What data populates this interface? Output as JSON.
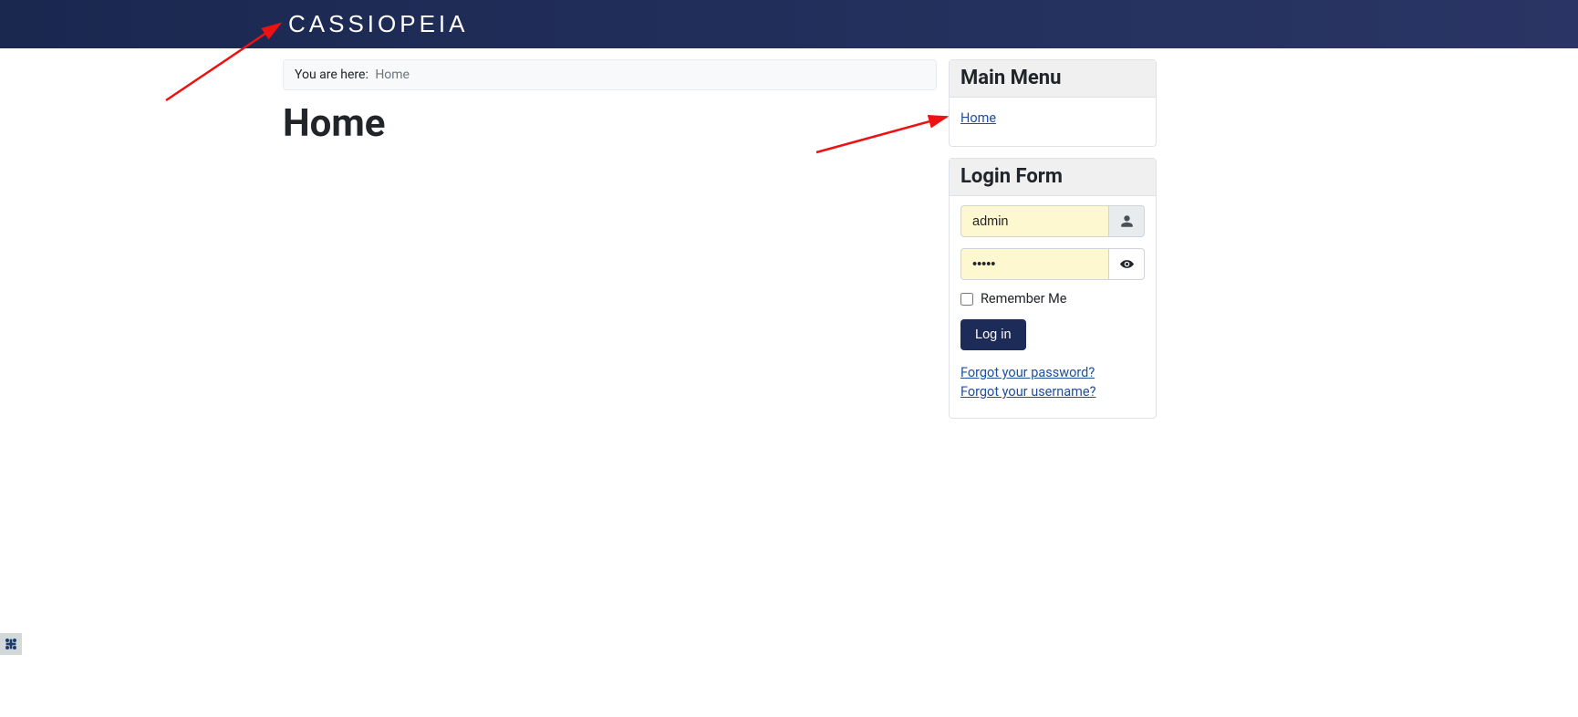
{
  "header": {
    "brand": "CASSIOPEIA"
  },
  "breadcrumb": {
    "label": "You are here:",
    "current": "Home"
  },
  "page": {
    "title": "Home"
  },
  "main_menu": {
    "title": "Main Menu",
    "items": [
      {
        "label": "Home"
      }
    ]
  },
  "login_form": {
    "title": "Login Form",
    "username_value": "admin",
    "password_value": "•••••",
    "remember_label": "Remember Me",
    "submit_label": "Log in",
    "forgot_password": "Forgot your password?",
    "forgot_username": "Forgot your username?"
  }
}
